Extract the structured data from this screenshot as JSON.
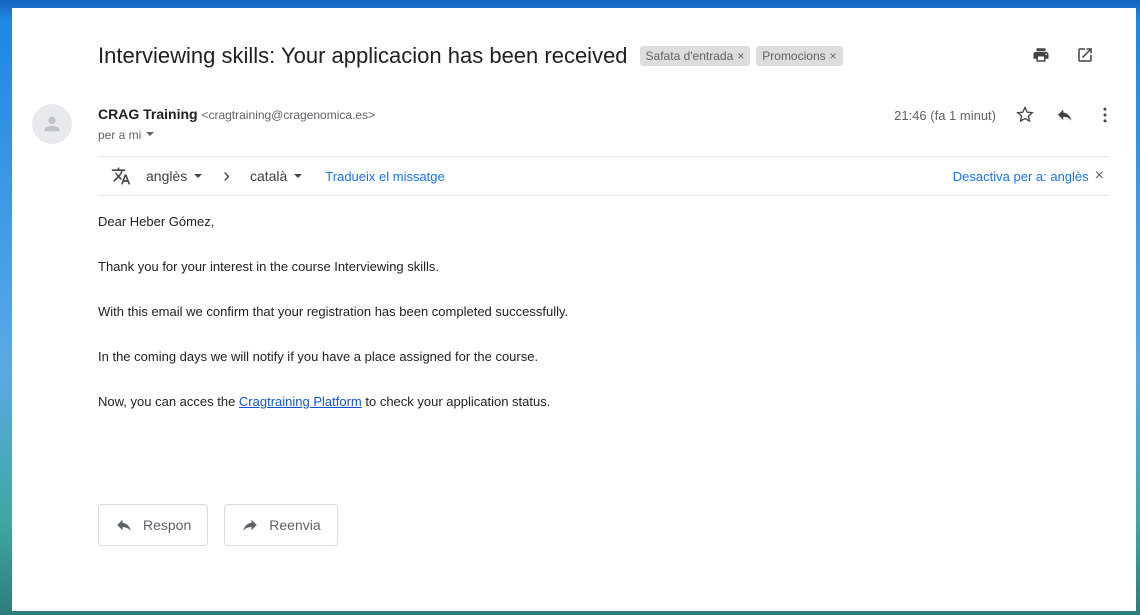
{
  "email": {
    "subject": "Interviewing skills: Your applicacion has been received",
    "labels": [
      {
        "name": "Safata d'entrada",
        "remove": "×"
      },
      {
        "name": "Promocions",
        "remove": "×"
      }
    ],
    "sender": {
      "name": "CRAG Training",
      "email": "<cragtraining@cragenomica.es>",
      "to": "per a mi"
    },
    "time": "21:46 (fa 1 minut)",
    "translate": {
      "from_lang": "anglès",
      "arrow": "›",
      "to_lang": "català",
      "translate_link": "Tradueix el missatge",
      "disable": "Desactiva per a: anglès",
      "close": "×"
    },
    "body": {
      "greeting": "Dear Heber Gómez,",
      "p1": "Thank you for your interest in the course Interviewing skills.",
      "p2": "With this email we confirm that your registration has been completed successfully.",
      "p3": "In the coming days we will notify if you have a place assigned for the course.",
      "p4_before": "Now, you can acces the ",
      "p4_link": "Cragtraining Platform",
      "p4_after": " to check your application status."
    },
    "actions": {
      "reply": "Respon",
      "forward": "Reenvia"
    }
  },
  "icons": {
    "print": "print-icon",
    "open_new": "open-in-new-window-icon",
    "star": "star-icon",
    "reply": "reply-icon",
    "more": "more-vertical-icon",
    "translate": "translate-icon",
    "dropdown": "chevron-down-icon",
    "avatar": "person-icon"
  }
}
